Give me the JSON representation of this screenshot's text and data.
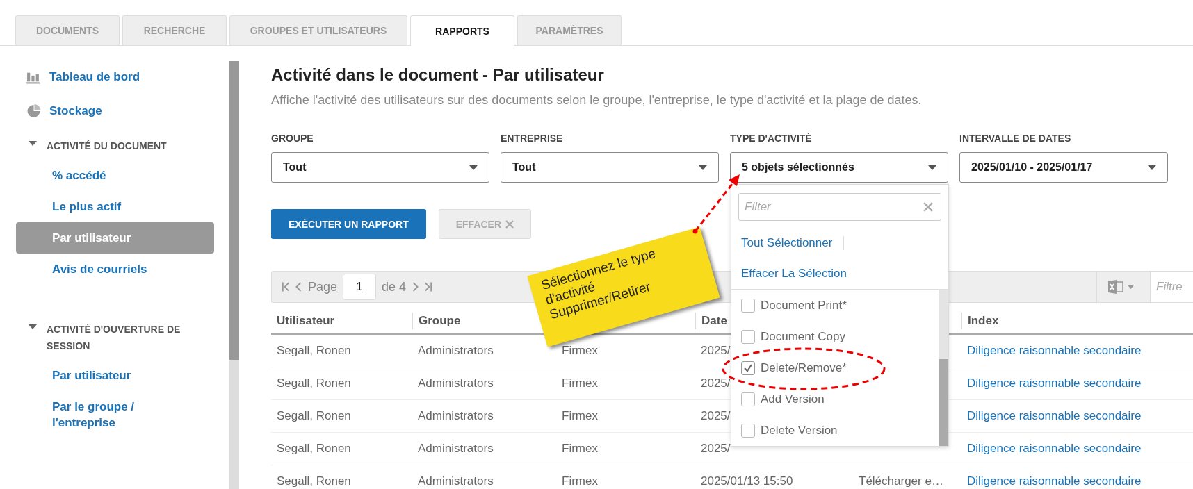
{
  "tabs": [
    {
      "label": "DOCUMENTS",
      "selected": false
    },
    {
      "label": "RECHERCHE",
      "selected": false
    },
    {
      "label": "GROUPES ET UTILISATEURS",
      "selected": false
    },
    {
      "label": "RAPPORTS",
      "selected": true
    },
    {
      "label": "PARAMÈTRES",
      "selected": false
    }
  ],
  "sidebar": {
    "items": [
      {
        "kind": "link",
        "label": "Tableau de bord"
      },
      {
        "kind": "link",
        "label": "Stockage"
      },
      {
        "kind": "section",
        "label": "ACTIVITÉ DU DOCUMENT",
        "expanded": true,
        "children": [
          {
            "label": "% accédé",
            "selected": false
          },
          {
            "label": "Le plus actif",
            "selected": false
          },
          {
            "label": "Par utilisateur",
            "selected": true
          },
          {
            "label": "Avis de courriels",
            "selected": false
          }
        ]
      },
      {
        "kind": "section",
        "label": "ACTIVITÉ D'OUVERTURE DE SESSION",
        "expanded": true,
        "children": [
          {
            "label": "Par utilisateur",
            "selected": false
          },
          {
            "label": "Par le groupe / l'entreprise",
            "selected": false
          }
        ]
      }
    ]
  },
  "page": {
    "title": "Activité dans le document - Par utilisateur",
    "subtitle": "Affiche l'activité des utilisateurs sur des documents selon le groupe, l'entreprise, le type d'activité et la plage de dates."
  },
  "filters": [
    {
      "label": "GROUPE",
      "value": "Tout"
    },
    {
      "label": "ENTREPRISE",
      "value": "Tout"
    },
    {
      "label": "TYPE D'ACTIVITÉ",
      "value": "5 objets sélectionnés",
      "menu": {
        "placeholder": "Filter",
        "select_all": "Tout Sélectionner",
        "clear_selection": "Effacer La Sélection",
        "options": [
          {
            "label": "Document Print*",
            "checked": false
          },
          {
            "label": "Document Copy",
            "checked": false
          },
          {
            "label": "Delete/Remove*",
            "checked": true
          },
          {
            "label": "Add Version",
            "checked": false
          },
          {
            "label": "Delete Version",
            "checked": false
          }
        ]
      }
    },
    {
      "label": "INTERVALLE DE DATES",
      "value": "2025/01/10 - 2025/01/17"
    }
  ],
  "buttons": [
    {
      "label": "EXÉCUTER UN RAPPORT",
      "kind": "primary",
      "disabled": false
    },
    {
      "label": "EFFACER",
      "kind": "clear",
      "disabled": true
    }
  ],
  "pager": {
    "page_label": "Page",
    "page": "1",
    "of": "de 4",
    "filter_placeholder": "Filtre"
  },
  "table": {
    "columns": [
      "Utilisateur",
      "Groupe",
      null,
      "Date",
      null,
      "Index"
    ],
    "rows": [
      {
        "cells": [
          "Segall, Ronen",
          "Administrators",
          "Firmex",
          "2025/",
          null,
          "Diligence raisonnable secondaire"
        ]
      },
      {
        "cells": [
          "Segall, Ronen",
          "Administrators",
          "Firmex",
          "2025/",
          null,
          "Diligence raisonnable secondaire"
        ]
      },
      {
        "cells": [
          "Segall, Ronen",
          "Administrators",
          "Firmex",
          "2025/",
          null,
          "Diligence raisonnable secondaire"
        ]
      },
      {
        "cells": [
          "Segall, Ronen",
          "Administrators",
          "Firmex",
          "2025/",
          null,
          "Diligence raisonnable secondaire"
        ]
      },
      {
        "cells": [
          "Segall, Ronen",
          "Administrators",
          "Firmex",
          "2025/01/13 15:50",
          "Télécharger e…",
          "Diligence raisonnable secondaire"
        ]
      }
    ]
  },
  "callout": {
    "text": "Sélectionnez le type\nd'activité\nSupprimer/Retirer"
  }
}
